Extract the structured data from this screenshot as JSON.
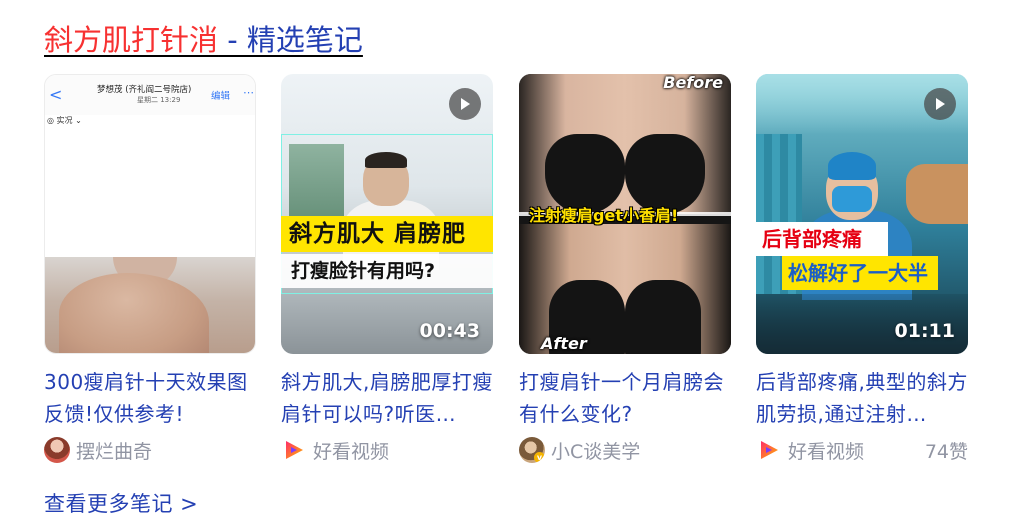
{
  "header": {
    "title_keyword": "斜方肌打针消",
    "title_suffix": " - 精选笔记"
  },
  "cards": [
    {
      "caption": "300瘦肩针十天效果图反馈!仅供参考!",
      "source": "摆烂曲奇",
      "thumb": {
        "shop": "梦想茂 (齐礼阎二号院店)",
        "date": "星期二 13:29",
        "edit": "编辑",
        "live": "实况",
        "back_glyph": "<",
        "dots_glyph": "⋯"
      }
    },
    {
      "caption": "斜方肌大,肩膀肥厚打瘦肩针可以吗?听医…",
      "source": "好看视频",
      "duration": "00:43",
      "thumb": {
        "banner_top": "斜方肌大 肩膀肥",
        "banner_bottom": "打瘦脸针有用吗?"
      }
    },
    {
      "caption": "打瘦肩针一个月肩膀会有什么变化?",
      "source": "小C谈美学",
      "thumb": {
        "before": "Before",
        "after": "After",
        "mid": "注射瘦肩get小香肩!"
      }
    },
    {
      "caption": "后背部疼痛,典型的斜方肌劳损,通过注射…",
      "source": "好看视频",
      "likes": "74赞",
      "duration": "01:11",
      "thumb": {
        "banner_top": "后背部疼痛",
        "banner_bottom": "松解好了一大半"
      }
    }
  ],
  "footer": {
    "more_link": "查看更多笔记 >"
  },
  "colors": {
    "keyword_red": "#f73131",
    "link_blue": "#2440b3",
    "meta_gray": "#9195a3"
  }
}
